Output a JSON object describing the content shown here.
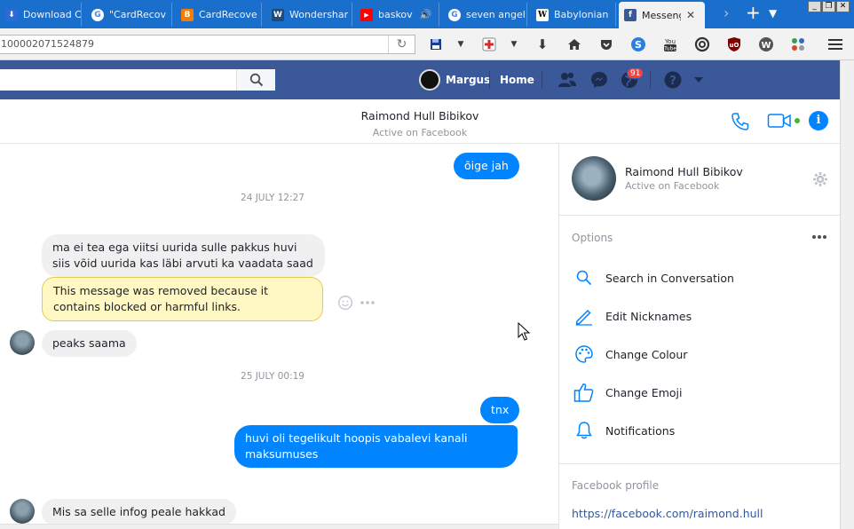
{
  "browser": {
    "tabs": [
      {
        "title": "Download C",
        "favicon": "blue-box-icon",
        "color": "#2b6bd6"
      },
      {
        "title": "\"CardRecov",
        "favicon": "google-icon",
        "color": "#ffffff"
      },
      {
        "title": "CardRecove",
        "favicon": "blogger-icon",
        "color": "#f57d00"
      },
      {
        "title": "Wondershar",
        "favicon": "wondershare-icon",
        "color": "#1e4b7a"
      },
      {
        "title": "baskov",
        "favicon": "youtube-icon",
        "color": "#ff0000"
      },
      {
        "title": "seven angel",
        "favicon": "google-icon",
        "color": "#ffffff"
      },
      {
        "title": "Babylonian",
        "favicon": "wikipedia-icon",
        "color": "#ffffff"
      },
      {
        "title": "Messeng",
        "favicon": "facebook-icon",
        "color": "#3b5998"
      }
    ],
    "url": "100002071524879"
  },
  "facebook": {
    "user_name": "Margus",
    "home_label": "Home",
    "notification_count": "91"
  },
  "conversation": {
    "contact_name": "Raimond Hull Bibikov",
    "status": "Active on Facebook"
  },
  "messages": {
    "m1": "õige jah",
    "stamp1": "24 JULY 12:27",
    "m2": "ma ei tea ega viitsi uurida sulle pakkus huvi siis võid uurida kas läbi arvuti ka vaadata saad",
    "m3": "This message was removed because it contains blocked or harmful links.",
    "m4": "peaks saama",
    "stamp2": "25 JULY 00:19",
    "m5": "tnx",
    "m6": "huvi oli tegelikult hoopis vabalevi kanali maksumuses",
    "m7": "Mis sa selle infog peale hakkad"
  },
  "panel": {
    "name": "Raimond Hull Bibikov",
    "status": "Active on Facebook",
    "options_header": "Options",
    "options": [
      {
        "label": "Search in Conversation",
        "icon": "search-icon"
      },
      {
        "label": "Edit Nicknames",
        "icon": "pencil-icon"
      },
      {
        "label": "Change Colour",
        "icon": "palette-icon"
      },
      {
        "label": "Change Emoji",
        "icon": "thumbs-up-icon"
      },
      {
        "label": "Notifications",
        "icon": "bell-icon"
      }
    ],
    "profile_header": "Facebook profile",
    "profile_link": "https://facebook.com/raimond.hull"
  },
  "colors": {
    "messenger_blue": "#0084ff",
    "facebook_blue": "#3b5998",
    "firefox_tab_blue": "#1a6fcd"
  }
}
